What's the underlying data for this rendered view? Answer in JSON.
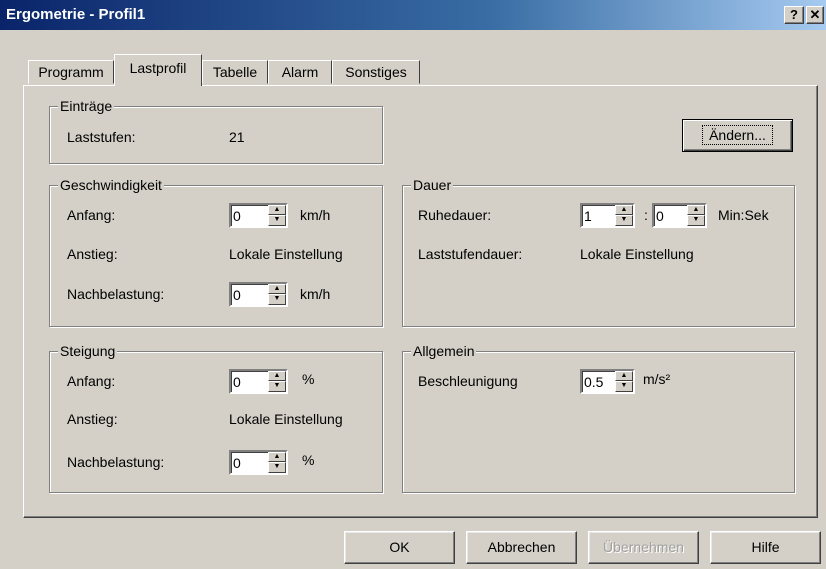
{
  "window": {
    "title": "Ergometrie - Profil1",
    "help_btn": "?",
    "close_btn": "✕"
  },
  "tabs": [
    {
      "label": "Programm"
    },
    {
      "label": "Lastprofil"
    },
    {
      "label": "Tabelle"
    },
    {
      "label": "Alarm"
    },
    {
      "label": "Sonstiges"
    }
  ],
  "eintraege": {
    "title": "Einträge",
    "laststufen_label": "Laststufen:",
    "laststufen_value": "21",
    "aendern_button": "Ändern..."
  },
  "geschwindigkeit": {
    "title": "Geschwindigkeit",
    "anfang_label": "Anfang:",
    "anfang_value": "0",
    "anfang_unit": "km/h",
    "anstieg_label": "Anstieg:",
    "anstieg_value": "Lokale Einstellung",
    "nachbelastung_label": "Nachbelastung:",
    "nachbelastung_value": "0",
    "nachbelastung_unit": "km/h"
  },
  "dauer": {
    "title": "Dauer",
    "ruhedauer_label": "Ruhedauer:",
    "ruhedauer_min": "1",
    "separator": ":",
    "ruhedauer_sec": "0",
    "ruhedauer_unit": "Min:Sek",
    "laststufendauer_label": "Laststufendauer:",
    "laststufendauer_value": "Lokale Einstellung"
  },
  "steigung": {
    "title": "Steigung",
    "anfang_label": "Anfang:",
    "anfang_value": "0",
    "anfang_unit": "%",
    "anstieg_label": "Anstieg:",
    "anstieg_value": "Lokale Einstellung",
    "nachbelastung_label": "Nachbelastung:",
    "nachbelastung_value": "0",
    "nachbelastung_unit": "%"
  },
  "allgemein": {
    "title": "Allgemein",
    "beschleunigung_label": "Beschleunigung",
    "beschleunigung_value": "0.5",
    "beschleunigung_unit": "m/s²"
  },
  "footer": {
    "ok": "OK",
    "abbrechen": "Abbrechen",
    "uebernehmen": "Übernehmen",
    "hilfe": "Hilfe"
  }
}
